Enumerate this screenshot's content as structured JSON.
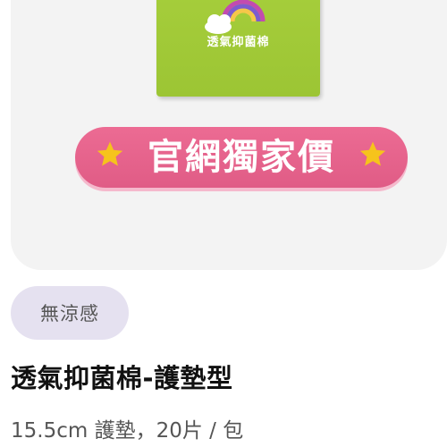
{
  "product_card": {
    "pack_label": "透氣抑菌棉",
    "promo_label": "官網獨家價",
    "tag_label": "無涼感",
    "title": "透氣抑菌棉-護墊型",
    "spec": "15.5cm 護墊，20片 / 包",
    "icons": {
      "pack_logo": "rainbow-cloud-icon",
      "promo_star_left": "star-icon",
      "promo_star_right": "star-icon"
    },
    "colors": {
      "panel_background": "#f3f3f3",
      "pack_green": "#a7cf3c",
      "promo_pink": "#e8658f",
      "star_yellow": "#f6c31c",
      "tag_background": "#e5e1f0",
      "title_text": "#111111",
      "spec_text": "#555555"
    }
  }
}
